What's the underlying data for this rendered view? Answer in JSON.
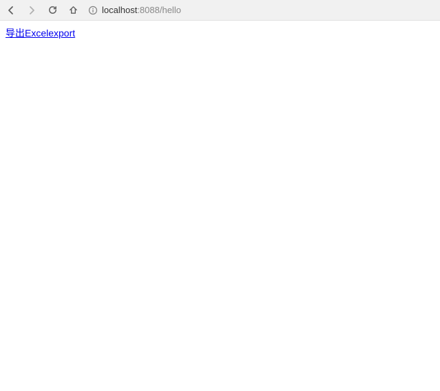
{
  "toolbar": {
    "url_host": "localhost",
    "url_port": ":8088",
    "url_path": "/hello"
  },
  "page": {
    "export_link_text": "导出Excelexport"
  }
}
